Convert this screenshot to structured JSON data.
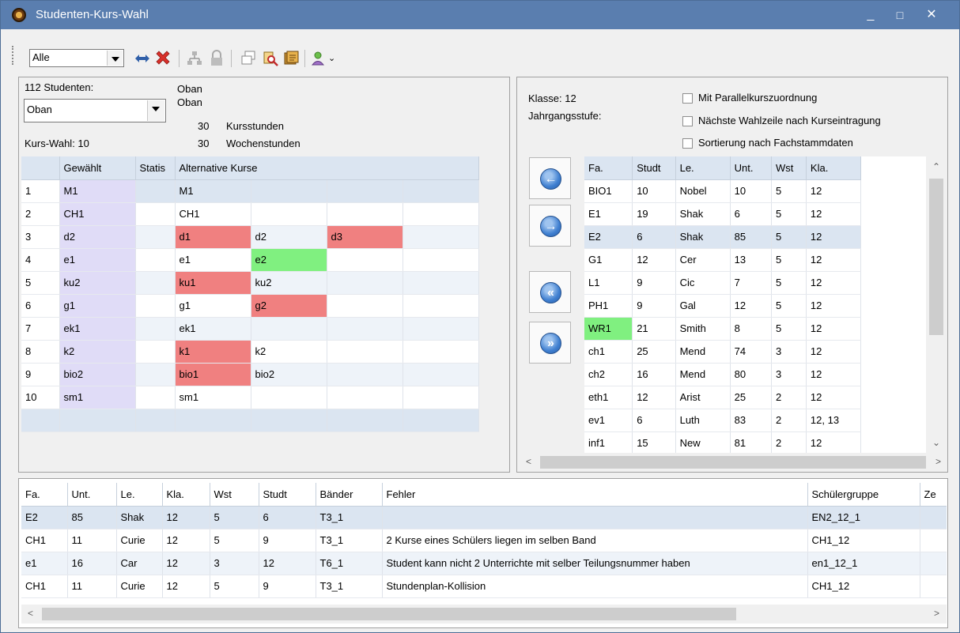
{
  "window": {
    "title": "Studenten-Kurs-Wahl",
    "minimize": "_",
    "maximize": "□",
    "close": "✕"
  },
  "toolbar": {
    "filter_value": "Alle"
  },
  "student_panel": {
    "count_label": "112 Studenten:",
    "student_value": "Oban",
    "name1": "Oban",
    "name2": "Oban",
    "kursstunden_num": "30",
    "kursstunden_label": "Kursstunden",
    "wochenstunden_num": "30",
    "wochenstunden_label": "Wochenstunden",
    "kurs_wahl": "Kurs-Wahl: 10"
  },
  "choice_grid": {
    "headers": [
      "",
      "Gewählt",
      "Statis",
      "Alternative Kurse"
    ],
    "rows": [
      {
        "n": "1",
        "g": "M1",
        "a": [
          "M1",
          "",
          "",
          ""
        ]
      },
      {
        "n": "2",
        "g": "CH1",
        "a": [
          "CH1",
          "",
          "",
          ""
        ]
      },
      {
        "n": "3",
        "g": "d2",
        "a": [
          "d1",
          "d2",
          "d3",
          ""
        ]
      },
      {
        "n": "4",
        "g": "e1",
        "a": [
          "e1",
          "e2",
          "",
          ""
        ]
      },
      {
        "n": "5",
        "g": "ku2",
        "a": [
          "ku1",
          "ku2",
          "",
          ""
        ]
      },
      {
        "n": "6",
        "g": "g1",
        "a": [
          "g1",
          "g2",
          "",
          ""
        ]
      },
      {
        "n": "7",
        "g": "ek1",
        "a": [
          "ek1",
          "",
          "",
          ""
        ]
      },
      {
        "n": "8",
        "g": "k2",
        "a": [
          "k1",
          "k2",
          "",
          ""
        ]
      },
      {
        "n": "9",
        "g": "bio2",
        "a": [
          "bio1",
          "bio2",
          "",
          ""
        ]
      },
      {
        "n": "10",
        "g": "sm1",
        "a": [
          "sm1",
          "",
          "",
          ""
        ]
      }
    ]
  },
  "options_panel": {
    "klasse": "Klasse: 12",
    "jahrgang": "Jahrgangsstufe:",
    "opt1": "Mit Parallelkurszuordnung",
    "opt2": "Nächste Wahlzeile nach Kurseintragung",
    "opt3": "Sortierung nach Fachstammdaten"
  },
  "course_grid": {
    "headers": [
      "Fa.",
      "Studt",
      "Le.",
      "Unt.",
      "Wst",
      "Kla."
    ],
    "rows": [
      [
        "BIO1",
        "10",
        "Nobel",
        "10",
        "5",
        "12"
      ],
      [
        "E1",
        "19",
        "Shak",
        "6",
        "5",
        "12"
      ],
      [
        "E2",
        "6",
        "Shak",
        "85",
        "5",
        "12"
      ],
      [
        "G1",
        "12",
        "Cer",
        "13",
        "5",
        "12"
      ],
      [
        "L1",
        "9",
        "Cic",
        "7",
        "5",
        "12"
      ],
      [
        "PH1",
        "9",
        "Gal",
        "12",
        "5",
        "12"
      ],
      [
        "WR1",
        "21",
        "Smith",
        "8",
        "5",
        "12"
      ],
      [
        "ch1",
        "25",
        "Mend",
        "74",
        "3",
        "12"
      ],
      [
        "ch2",
        "16",
        "Mend",
        "80",
        "3",
        "12"
      ],
      [
        "eth1",
        "12",
        "Arist",
        "25",
        "2",
        "12"
      ],
      [
        "ev1",
        "6",
        "Luth",
        "83",
        "2",
        "12, 13"
      ],
      [
        "inf1",
        "15",
        "New",
        "81",
        "2",
        "12"
      ]
    ]
  },
  "bottom_grid": {
    "headers": [
      "Fa.",
      "Unt.",
      "Le.",
      "Kla.",
      "Wst",
      "Studt",
      "Bänder",
      "Fehler",
      "Schülergruppe",
      "Ze"
    ],
    "rows": [
      [
        "E2",
        "85",
        "Shak",
        "12",
        "5",
        "6",
        "T3_1",
        "",
        "EN2_12_1",
        ""
      ],
      [
        "CH1",
        "11",
        "Curie",
        "12",
        "5",
        "9",
        "T3_1",
        "2 Kurse eines Schülers liegen im selben Band",
        "CH1_12",
        ""
      ],
      [
        "e1",
        "16",
        "Car",
        "12",
        "3",
        "12",
        "T6_1",
        "Student kann nicht 2 Unterrichte mit selber Teilungsnummer haben",
        "en1_12_1",
        ""
      ],
      [
        "CH1",
        "11",
        "Curie",
        "12",
        "5",
        "9",
        "T3_1",
        "Stundenplan-Kollision",
        "CH1_12",
        ""
      ]
    ]
  }
}
